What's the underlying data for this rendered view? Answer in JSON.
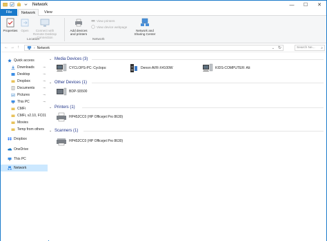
{
  "window": {
    "title": "Network",
    "controls": {
      "minimize": "—",
      "maximize": "☐",
      "close": "✕"
    }
  },
  "ribbon": {
    "tabs": [
      "File",
      "Network",
      "View"
    ],
    "buttons": {
      "properties": "Properties",
      "open": "Open",
      "connect": "Connect with Remote Desktop Connection",
      "add_devices": "Add devices and printers",
      "view_printers": "View printers",
      "view_webpage": "View device webpage",
      "network_sharing": "Network and Sharing Center"
    },
    "groups": {
      "location": "Location",
      "network": "Network"
    }
  },
  "address": {
    "back": "←",
    "forward": "→",
    "up": "↑",
    "path": "Network",
    "search_placeholder": "Search Ne...",
    "search_icon": "search-icon"
  },
  "nav": {
    "quick_access": "Quick access",
    "items": [
      {
        "label": "Downloads",
        "pinned": true
      },
      {
        "label": "Desktop",
        "pinned": true
      },
      {
        "label": "Dropbox",
        "pinned": true
      },
      {
        "label": "Documents",
        "pinned": true
      },
      {
        "label": "Pictures",
        "pinned": true
      },
      {
        "label": "This PC",
        "pinned": true
      },
      {
        "label": "CMFi",
        "pinned": false
      },
      {
        "label": "CMFi, v2.10, FC01",
        "pinned": false
      },
      {
        "label": "Movies",
        "pinned": false
      },
      {
        "label": "Temp from others",
        "pinned": false
      }
    ],
    "dropbox": "Dropbox",
    "onedrive": "OneDrive",
    "thispc": "This PC",
    "network": "Network",
    "pin_glyph": "⊸"
  },
  "content": {
    "groups": [
      {
        "header": "Media Devices (3)",
        "devices": [
          "CYCLOPS-PC: Cyclops:",
          "Denon AVR-X4100W",
          "KIDS-COMPUTER: Ali:"
        ]
      },
      {
        "header": "Other Devices (1)",
        "devices": [
          "BDP-S5500"
        ]
      },
      {
        "header": "Printers (1)",
        "devices": [
          "HP452CC0 (HP Officejet Pro 8630)"
        ]
      },
      {
        "header": "Scanners (1)",
        "devices": [
          "HP452CC0 (HP Officejet Pro 8630)"
        ]
      }
    ]
  },
  "colors": {
    "accent": "#1979ca",
    "group_header": "#1e3287",
    "selection": "#cce8ff"
  }
}
